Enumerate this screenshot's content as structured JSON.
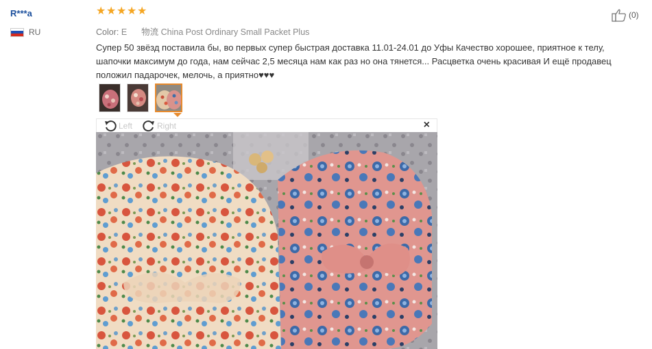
{
  "reviewer": {
    "name": "R***a",
    "country": "RU",
    "flag_colors": [
      "#ffffff",
      "#1f4fb5",
      "#d52b1e"
    ]
  },
  "rating": {
    "stars": 5,
    "max": 5,
    "color": "#f5a623"
  },
  "order_info": {
    "color_label": "Color:",
    "color_value": "E",
    "shipping_label": "物流",
    "shipping_value": "China Post Ordinary Small Packet Plus"
  },
  "review_text": "Супер 50 звёзд поставила бы, во первых супер быстрая доставка 11.01-24.01 до Уфы Качество хорошее, приятное к телу, шапочки максимум до года, нам сейчас 2,5 месяца нам как раз но она тянется... Расцветка очень красивая И ещё продавец положил падарочек, мелочь, а приятно♥♥♥",
  "photos": {
    "thumbnail_count": 3,
    "active_index": 2
  },
  "viewer": {
    "rotate_left_label": "Left",
    "rotate_right_label": "Right",
    "close_icon": "×"
  },
  "helpful": {
    "count": "(0)",
    "icon": "thumbs-up-icon"
  },
  "colors": {
    "accent": "#e88a2c",
    "username": "#1a4e9c"
  }
}
